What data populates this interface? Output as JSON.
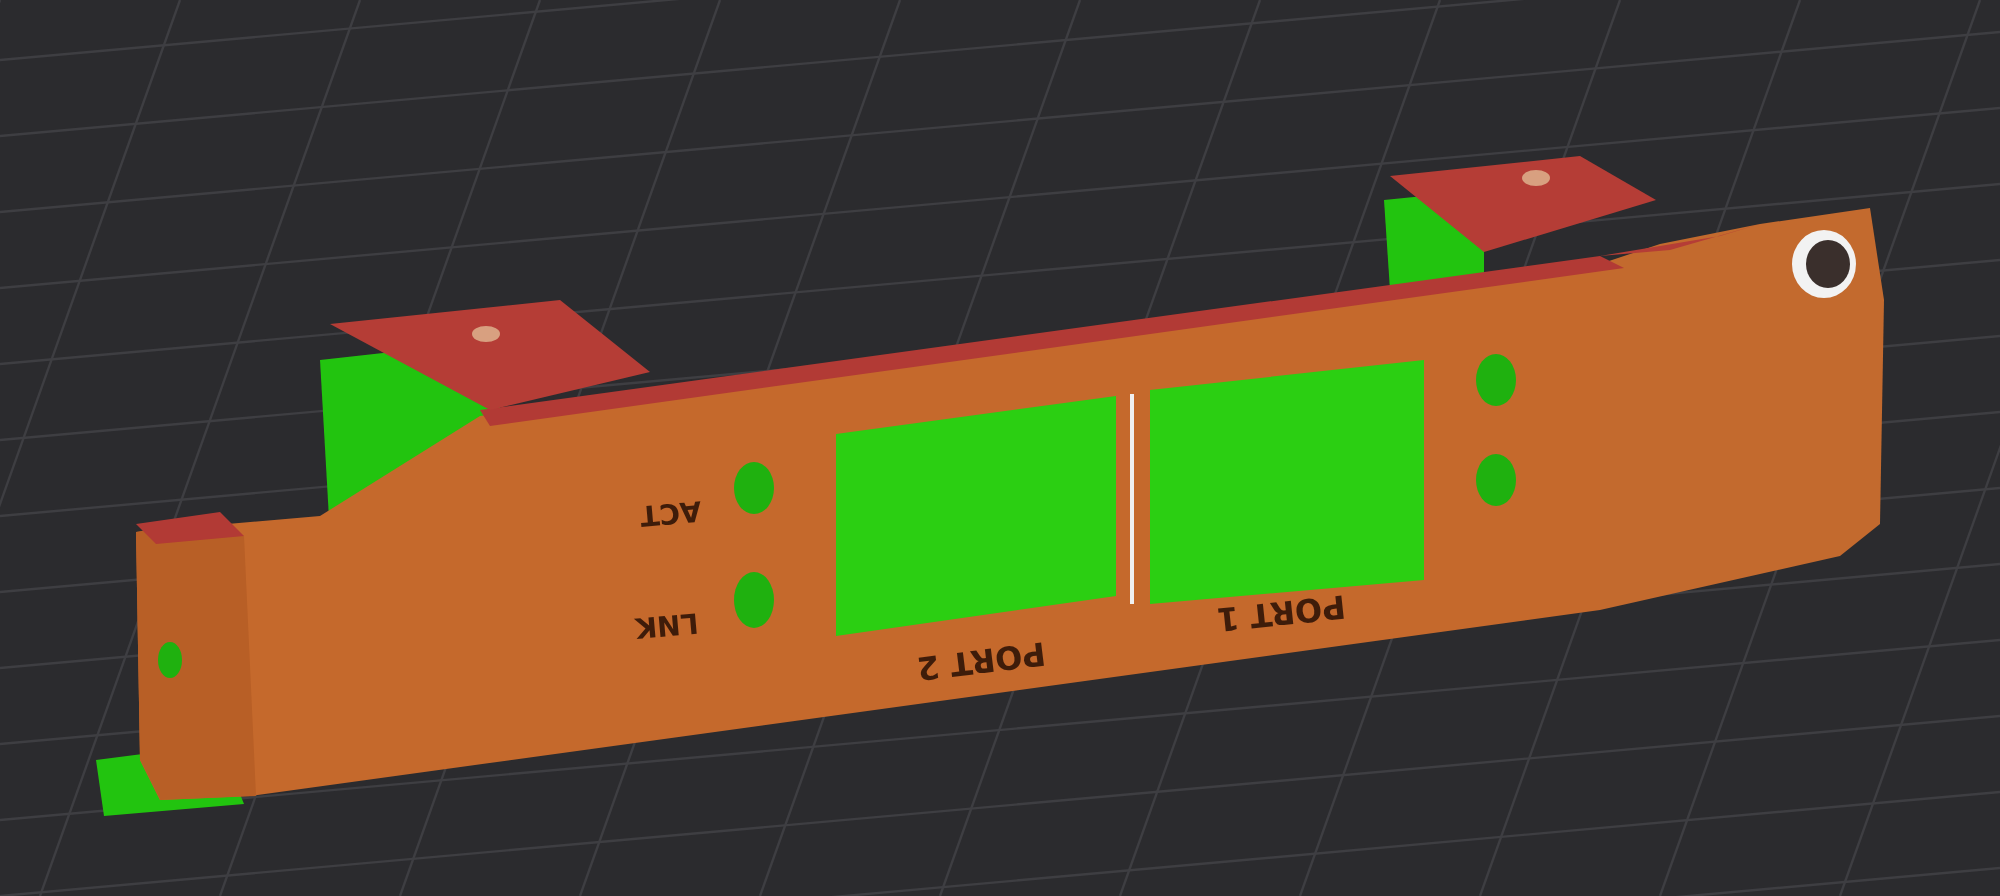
{
  "viewport": {
    "model_labels": [
      {
        "text": "ACT"
      },
      {
        "text": "LNK"
      },
      {
        "text": "PORT 2"
      },
      {
        "text": "PORT 1"
      }
    ]
  }
}
